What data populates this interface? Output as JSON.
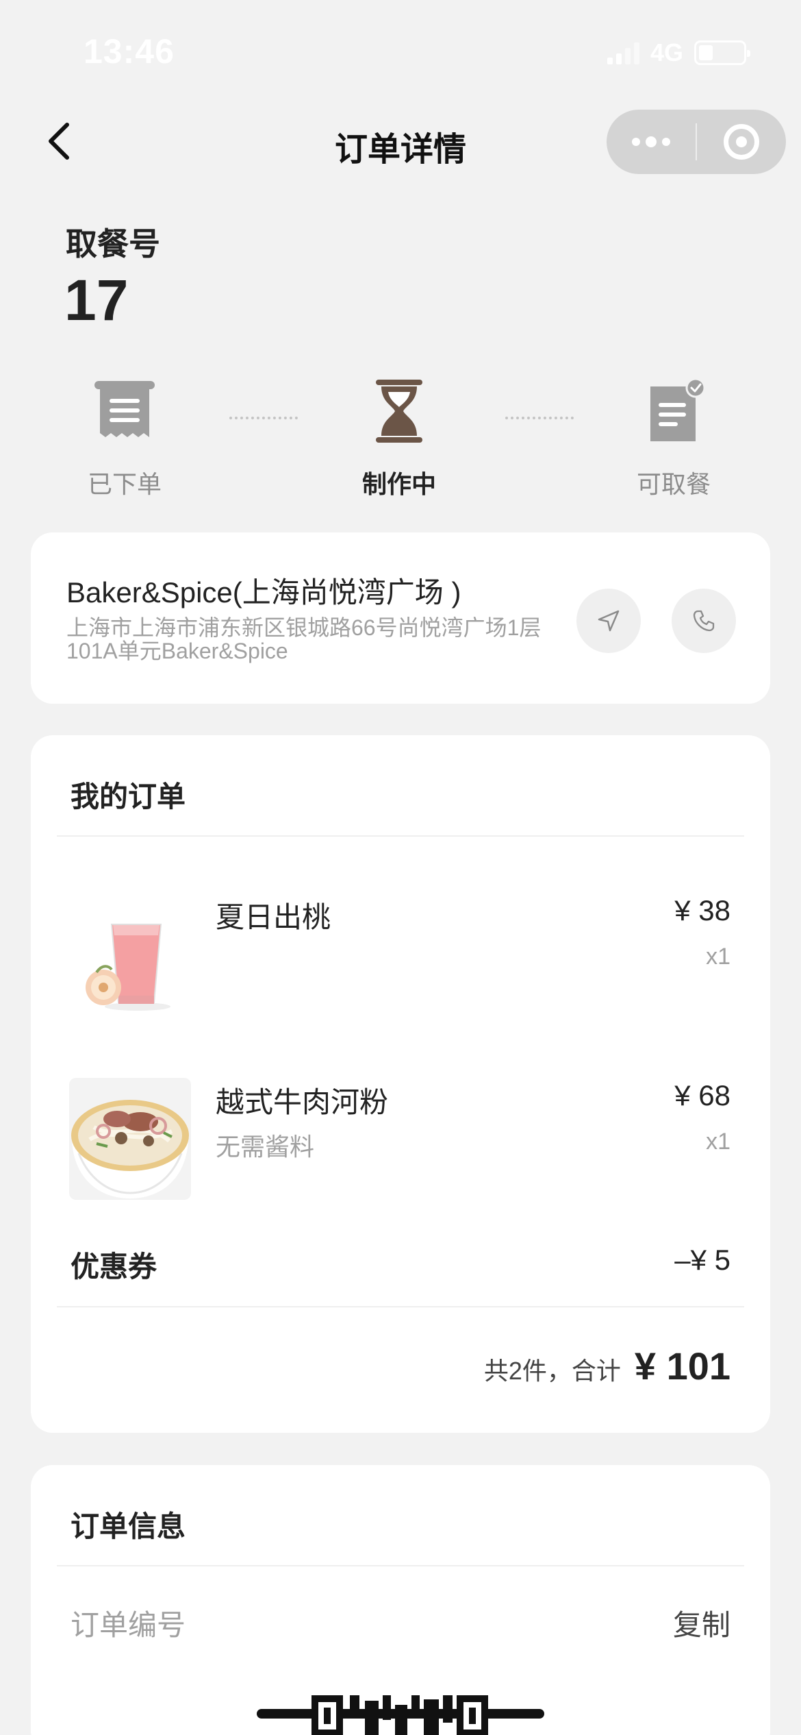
{
  "status_bar": {
    "time": "13:46",
    "network": "4G"
  },
  "nav": {
    "title": "订单详情",
    "more_icon": "more-dots-icon",
    "close_icon": "capsule-close-icon",
    "back_icon": "back-chevron-icon"
  },
  "pickup": {
    "label": "取餐号",
    "number": "17"
  },
  "steps": [
    {
      "label": "已下单",
      "icon": "receipt-icon",
      "state": "done"
    },
    {
      "label": "制作中",
      "icon": "hourglass-icon",
      "state": "active"
    },
    {
      "label": "可取餐",
      "icon": "ready-document-icon",
      "state": "pending"
    }
  ],
  "store": {
    "name": "Baker&Spice(上海尚悦湾广场 )",
    "address": "上海市上海市浦东新区银城路66号尚悦湾广场1层101A单元Baker&Spice",
    "nav_icon": "navigation-arrow-icon",
    "phone_icon": "phone-icon"
  },
  "order": {
    "title": "我的订单",
    "items": [
      {
        "name": "夏日出桃",
        "note": "",
        "price": "¥ 38",
        "qty": "x1",
        "image": "peach-drink-image"
      },
      {
        "name": "越式牛肉河粉",
        "note": "无需酱料",
        "price": "¥ 68",
        "qty": "x1",
        "image": "beef-pho-image"
      }
    ],
    "coupon_label": "优惠券",
    "coupon_value": "–¥ 5",
    "total_count": "共2件，合计",
    "total_amount": "¥ 101"
  },
  "info": {
    "title": "订单信息",
    "order_no_label": "订单编号",
    "copy_label": "复制"
  },
  "colors": {
    "background": "#f2f2f2",
    "card": "#ffffff",
    "step_active": "#6b5547",
    "step_inactive": "#9e9e9e"
  }
}
